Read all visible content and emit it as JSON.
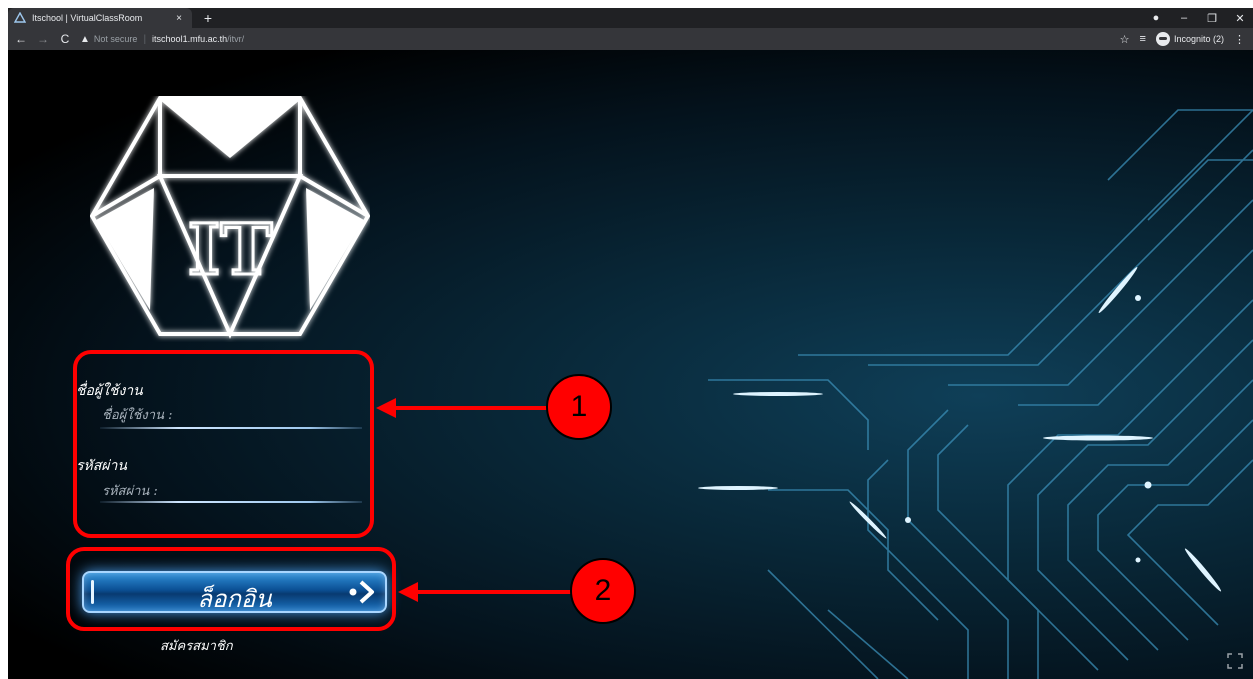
{
  "browser": {
    "tab_title": "Itschool | VirtualClassRoom",
    "tab_close": "×",
    "new_tab": "+",
    "address": {
      "warning": "Not secure",
      "host": "itschool1.mfu.ac.th",
      "path": "/itvr/"
    },
    "incognito_label": "Incognito (2)"
  },
  "login": {
    "username_label": "ชื่อผู้ใช้งาน",
    "username_placeholder": "ชื่อผู้ใช้งาน :",
    "password_label": "รหัสผ่าน",
    "password_placeholder": "รหัสผ่าน :",
    "login_button": "ล็อกอิน",
    "register_link": "สมัครสมาชิก"
  },
  "logo": {
    "text": "IT"
  },
  "annotations": [
    {
      "label": "1"
    },
    {
      "label": "2"
    }
  ],
  "colors": {
    "annotation": "#ff0000",
    "button_blue": "#0b4f93",
    "glow": "#a9d6ff"
  }
}
